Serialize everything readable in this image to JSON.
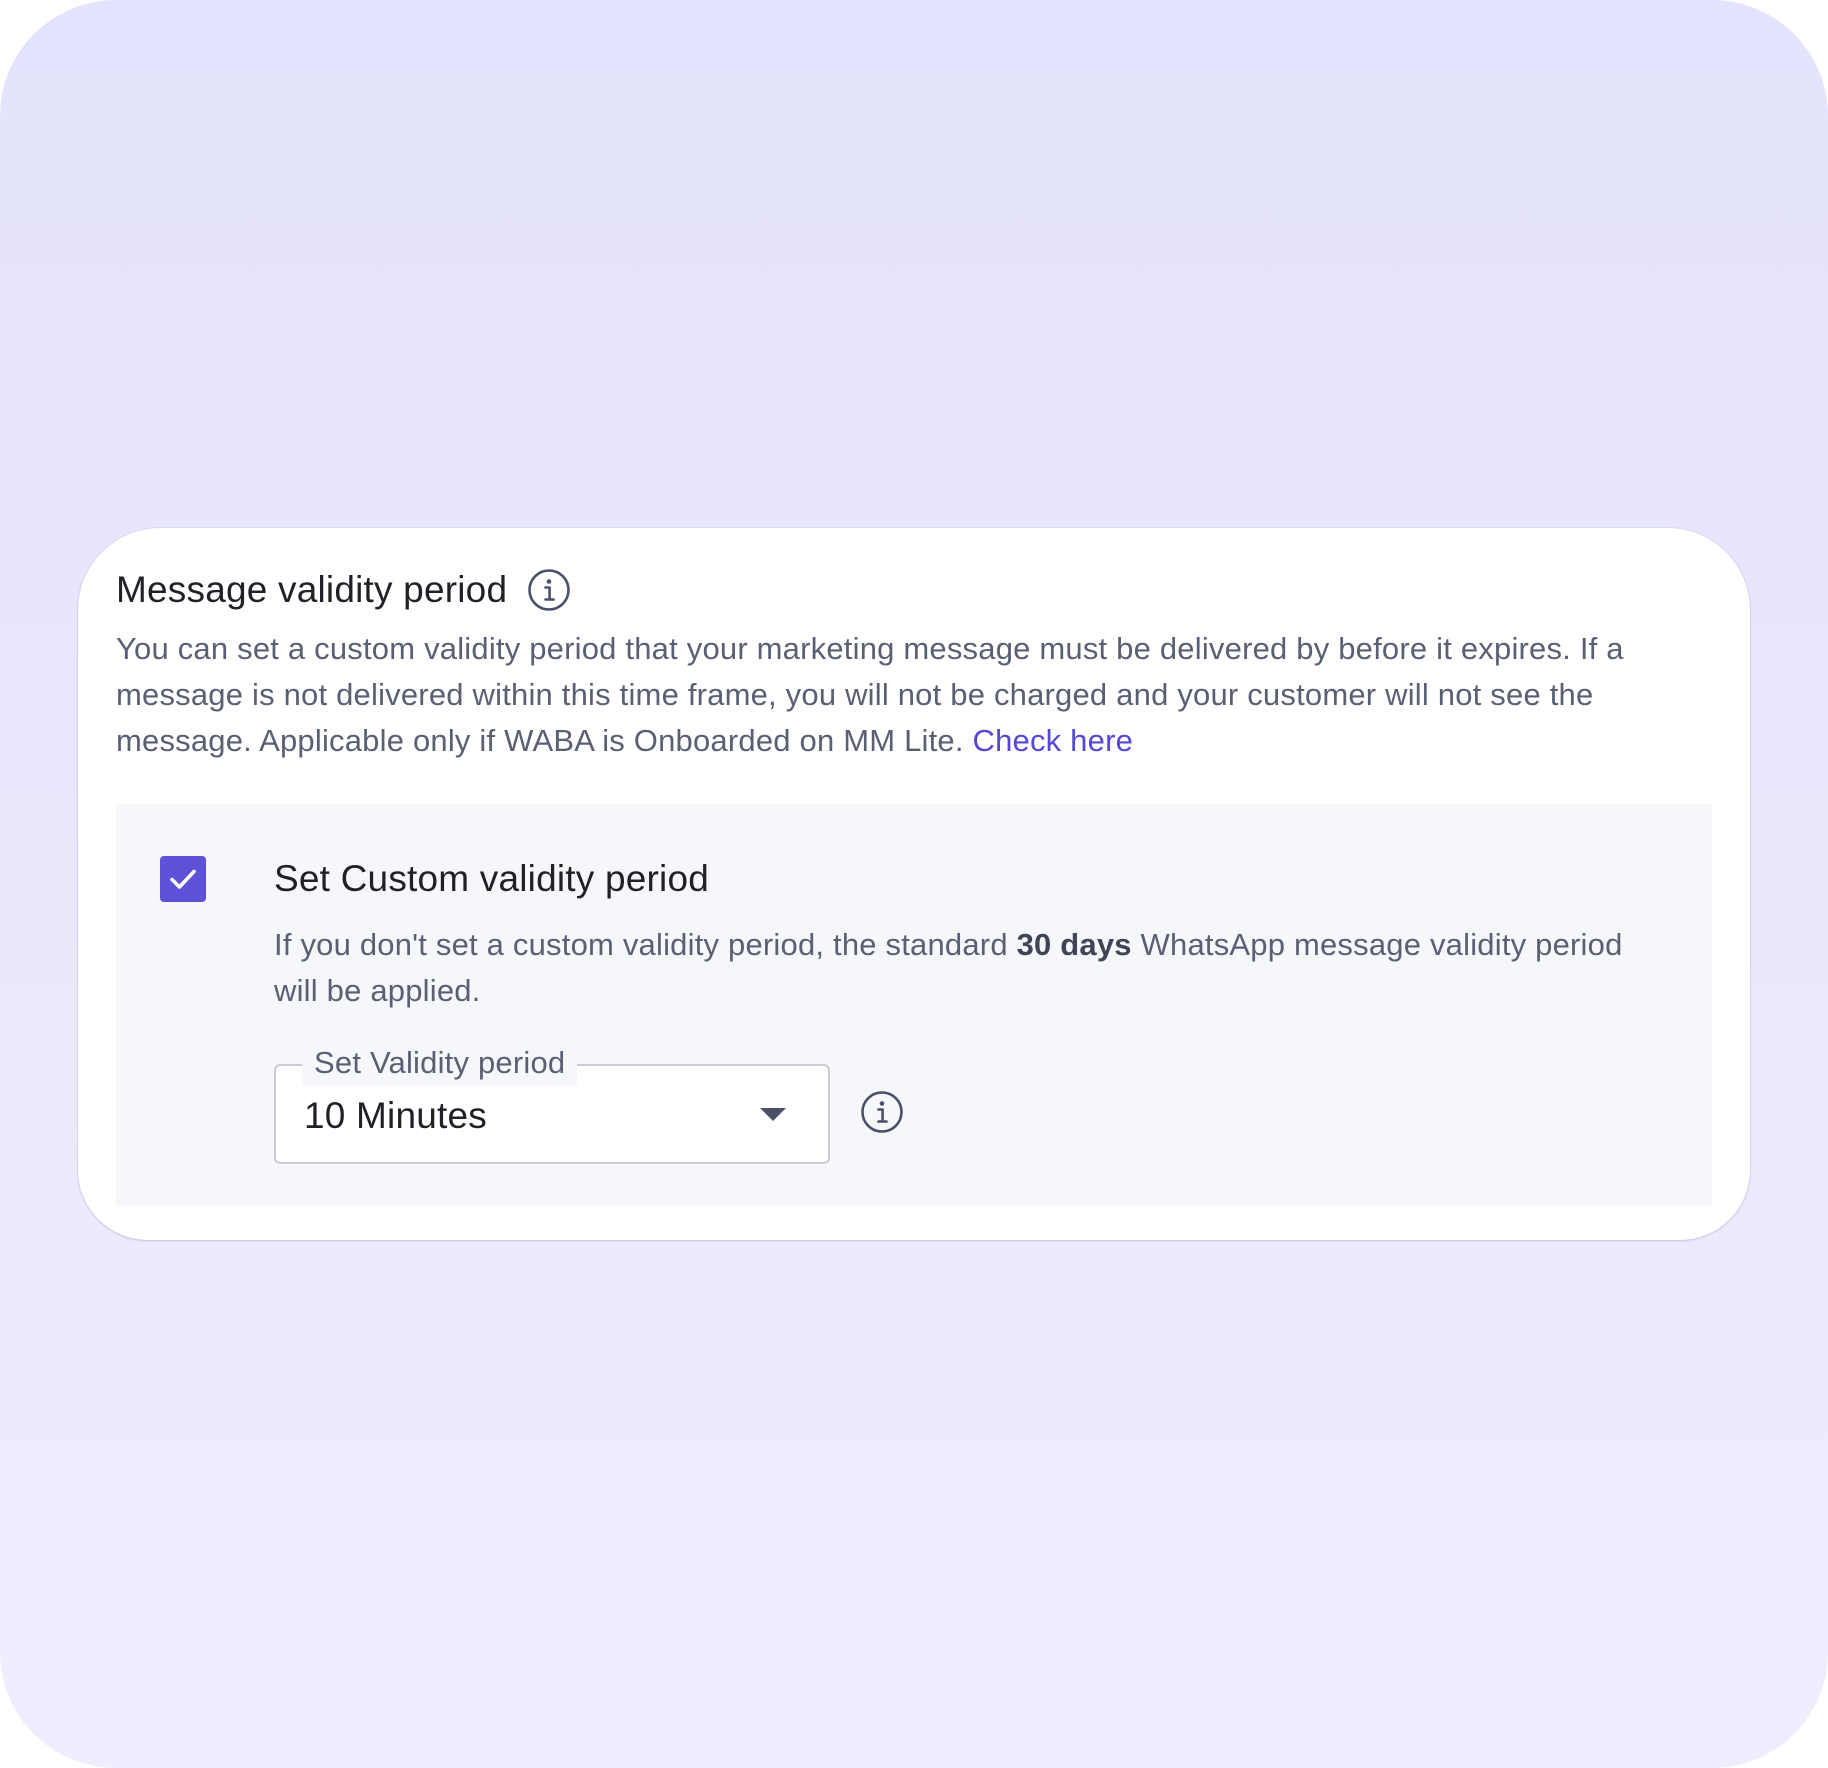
{
  "section": {
    "title": "Message validity period",
    "title_info_icon": "info-circle-icon",
    "description_text": "You can set a custom validity period that your marketing message must be delivered by before it expires. If a message is not delivered within this time frame, you will not be charged and your customer will not see the message. Applicable only if WABA is Onboarded on MM Lite. ",
    "description_link": "Check here"
  },
  "custom_validity": {
    "checkbox_checked": true,
    "checkbox_icon": "checkmark-icon",
    "label": "Set Custom validity period",
    "hint_before": "If you don't set a custom validity period, the standard ",
    "hint_bold": "30 days",
    "hint_after": " WhatsApp message validity period will be applied.",
    "select": {
      "legend": "Set Validity period",
      "value": "10 Minutes",
      "arrow_icon": "caret-down-icon"
    },
    "info_icon": "info-circle-icon"
  },
  "colors": {
    "background": "#e4e3fd",
    "card": "#ffffff",
    "panel": "#f6f7fb",
    "accent": "#5c51d8",
    "link": "#5548d6",
    "text_primary": "#1f2126",
    "text_secondary": "#5a5f73"
  }
}
